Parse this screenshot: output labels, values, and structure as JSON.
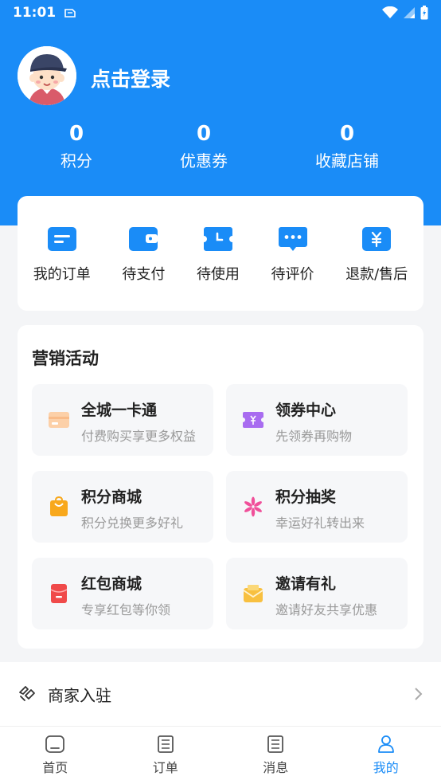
{
  "status_bar": {
    "time": "11:01"
  },
  "profile": {
    "login_text": "点击登录"
  },
  "stats": [
    {
      "value": "0",
      "label": "积分"
    },
    {
      "value": "0",
      "label": "优惠券"
    },
    {
      "value": "0",
      "label": "收藏店铺"
    }
  ],
  "orders": [
    {
      "label": "我的订单",
      "icon": "order-list-icon"
    },
    {
      "label": "待支付",
      "icon": "wallet-icon"
    },
    {
      "label": "待使用",
      "icon": "ticket-icon"
    },
    {
      "label": "待评价",
      "icon": "comment-icon"
    },
    {
      "label": "退款/售后",
      "icon": "refund-icon"
    }
  ],
  "marketing": {
    "title": "营销活动",
    "items": [
      {
        "name": "全城一卡通",
        "desc": "付费购买享更多权益",
        "icon": "card-icon",
        "color": "#fcd0a8"
      },
      {
        "name": "领券中心",
        "desc": "先领券再购物",
        "icon": "coupon-icon",
        "color": "#a86cf0"
      },
      {
        "name": "积分商城",
        "desc": "积分兑换更多好礼",
        "icon": "bag-icon",
        "color": "#f8a81c"
      },
      {
        "name": "积分抽奖",
        "desc": "幸运好礼转出来",
        "icon": "pinwheel-icon",
        "color": "#f0509a"
      },
      {
        "name": "红包商城",
        "desc": "专享红包等你领",
        "icon": "red-packet-icon",
        "color": "#f04a4a"
      },
      {
        "name": "邀请有礼",
        "desc": "邀请好友共享优惠",
        "icon": "envelope-icon",
        "color": "#f8c040"
      }
    ]
  },
  "merchant": {
    "label": "商家入驻"
  },
  "tabs": [
    {
      "label": "首页",
      "icon": "home-icon",
      "active": false
    },
    {
      "label": "订单",
      "icon": "order-icon",
      "active": false
    },
    {
      "label": "消息",
      "icon": "message-icon",
      "active": false
    },
    {
      "label": "我的",
      "icon": "user-icon",
      "active": true
    }
  ],
  "colors": {
    "primary": "#1a8cf7"
  }
}
